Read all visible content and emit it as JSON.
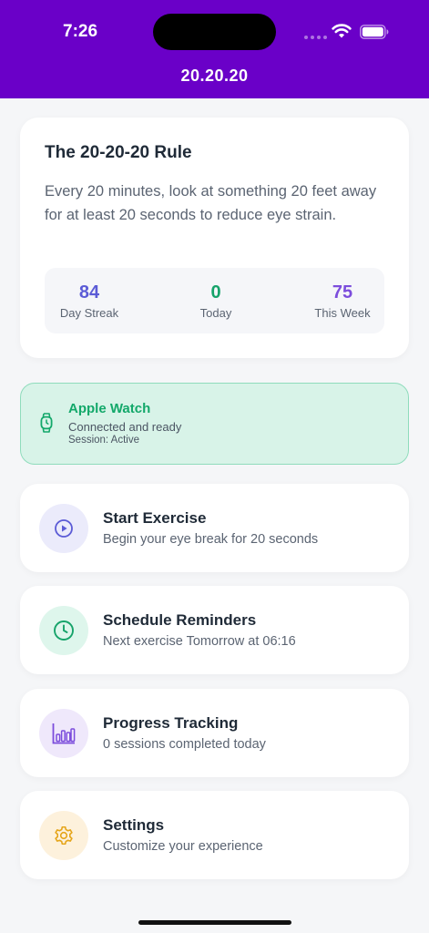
{
  "status_bar": {
    "time": "7:26"
  },
  "nav": {
    "title": "20.20.20"
  },
  "rule_card": {
    "title": "The 20-20-20 Rule",
    "description": "Every 20 minutes, look at something 20 feet away for at least 20 seconds to reduce eye strain.",
    "stats": [
      {
        "value": "84",
        "label": "Day Streak"
      },
      {
        "value": "0",
        "label": "Today"
      },
      {
        "value": "75",
        "label": "This Week"
      }
    ]
  },
  "watch": {
    "title": "Apple Watch",
    "status": "Connected and ready",
    "session": "Session: Active",
    "icon": "watch-icon"
  },
  "menu": [
    {
      "title": "Start Exercise",
      "subtitle": "Begin your eye break for 20 seconds",
      "icon": "play-icon",
      "icon_bg": "#ebebfb",
      "icon_color": "#5b5bd6"
    },
    {
      "title": "Schedule Reminders",
      "subtitle": "Next exercise Tomorrow at 06:16",
      "icon": "clock-icon",
      "icon_bg": "#def6ec",
      "icon_color": "#16a36a"
    },
    {
      "title": "Progress Tracking",
      "subtitle": "0 sessions completed today",
      "icon": "bar-chart-icon",
      "icon_bg": "#efe8fb",
      "icon_color": "#7c4ddc"
    },
    {
      "title": "Settings",
      "subtitle": "Customize your experience",
      "icon": "gear-icon",
      "icon_bg": "#fdf1dc",
      "icon_color": "#e5a51a"
    }
  ],
  "colors": {
    "header": "#6a00c8",
    "accent_green": "#13a86a",
    "accent_indigo": "#5b5bd6",
    "accent_purple": "#7c4ddc"
  }
}
